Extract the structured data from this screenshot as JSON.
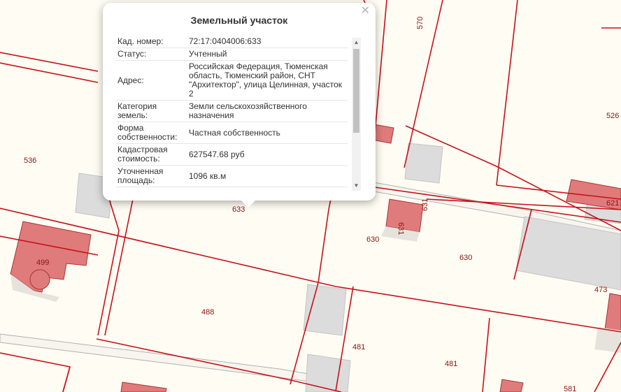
{
  "map": {
    "colors": {
      "background": "#fffdf3",
      "boundary": "#c8101a",
      "building_pink": "#e07b7b",
      "building_gray": "#dcdcdc"
    },
    "labels": [
      "570",
      "526",
      "536",
      "633",
      "631",
      "631",
      "630",
      "630",
      "621",
      "499",
      "488",
      "473",
      "481",
      "481",
      "581"
    ]
  },
  "popup": {
    "title": "Земельный участок",
    "close_icon": "✕",
    "rows": [
      {
        "key": "Кад. номер:",
        "value": "72:17:0404006:633"
      },
      {
        "key": "Статус:",
        "value": "Учтенный"
      },
      {
        "key": "Адрес:",
        "value": "Российская Федерация, Тюменская область, Тюменский район, СНТ \"Архитектор\", улица Целинная, участок 2"
      },
      {
        "key": "Категория земель:",
        "value": "Земли сельскохозяйственного назначения"
      },
      {
        "key": "Форма собственности:",
        "value": "Частная собственность"
      },
      {
        "key": "Кадастровая стоимость:",
        "value": "627547.68 руб"
      },
      {
        "key": "Уточненная площадь:",
        "value": "1096 кв.м"
      }
    ]
  }
}
